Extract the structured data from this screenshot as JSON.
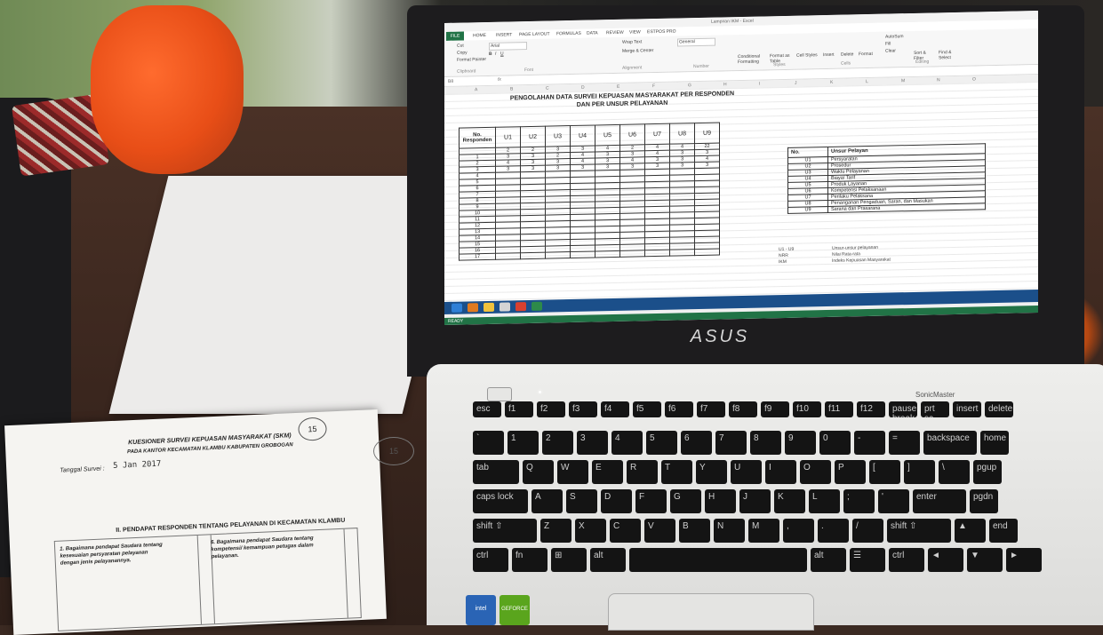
{
  "excel": {
    "window_title": "Lampiran IKM - Excel",
    "tabs": [
      "FILE",
      "HOME",
      "INSERT",
      "PAGE LAYOUT",
      "FORMULAS",
      "DATA",
      "REVIEW",
      "VIEW",
      "ESTPOS PRO"
    ],
    "ribbon": {
      "cut": "Cut",
      "copy": "Copy",
      "format_painter": "Format Painter",
      "font": "Arial",
      "wrap_text": "Wrap Text",
      "merge_center": "Merge & Center",
      "number_format": "General",
      "conditional_formatting": "Conditional Formatting",
      "format_as_table": "Format as Table",
      "cell_styles": "Cell Styles",
      "insert": "Insert",
      "delete": "Delete",
      "format": "Format",
      "autosum": "AutoSum",
      "fill": "Fill",
      "clear": "Clear",
      "sort_filter": "Sort & Filter",
      "find_select": "Find & Select",
      "groups": [
        "Clipboard",
        "Font",
        "Alignment",
        "Number",
        "Styles",
        "Cells",
        "Editing"
      ]
    },
    "name_box": "B8",
    "columns": [
      "A",
      "B",
      "C",
      "D",
      "E",
      "F",
      "G",
      "H",
      "I",
      "J",
      "K",
      "L",
      "M",
      "N",
      "O"
    ],
    "sheet_title_line1": "PENGOLAHAN DATA SURVEI KEPUASAN MASYARAKAT PER RESPONDEN",
    "sheet_title_line2": "DAN PER UNSUR PELAYANAN",
    "table": {
      "header_no": "No. Responden",
      "header_units": [
        "U1",
        "U2",
        "U3",
        "U4",
        "U5",
        "U6",
        "U7",
        "U8",
        "U9"
      ],
      "top_row": [
        "",
        "2",
        "2",
        "3",
        "3",
        "4",
        "2",
        "4",
        "4",
        "22"
      ],
      "rows": [
        [
          "1",
          "3",
          "3",
          "2",
          "4",
          "3",
          "3",
          "4",
          "3",
          "3"
        ],
        [
          "2",
          "4",
          "3",
          "3",
          "4",
          "3",
          "4",
          "3",
          "3",
          "4"
        ],
        [
          "3",
          "3",
          "3",
          "3",
          "3",
          "3",
          "3",
          "3",
          "3",
          "3"
        ],
        [
          "4",
          "",
          "",
          "",
          "",
          "",
          "",
          "",
          "",
          ""
        ],
        [
          "5",
          "",
          "",
          "",
          "",
          "",
          "",
          "",
          "",
          ""
        ],
        [
          "6",
          "",
          "",
          "",
          "",
          "",
          "",
          "",
          "",
          ""
        ],
        [
          "7",
          "",
          "",
          "",
          "",
          "",
          "",
          "",
          "",
          ""
        ],
        [
          "8",
          "",
          "",
          "",
          "",
          "",
          "",
          "",
          "",
          ""
        ],
        [
          "9",
          "",
          "",
          "",
          "",
          "",
          "",
          "",
          "",
          ""
        ],
        [
          "10",
          "",
          "",
          "",
          "",
          "",
          "",
          "",
          "",
          ""
        ],
        [
          "11",
          "",
          "",
          "",
          "",
          "",
          "",
          "",
          "",
          ""
        ],
        [
          "12",
          "",
          "",
          "",
          "",
          "",
          "",
          "",
          "",
          ""
        ],
        [
          "13",
          "",
          "",
          "",
          "",
          "",
          "",
          "",
          "",
          ""
        ],
        [
          "14",
          "",
          "",
          "",
          "",
          "",
          "",
          "",
          "",
          ""
        ],
        [
          "15",
          "",
          "",
          "",
          "",
          "",
          "",
          "",
          "",
          ""
        ],
        [
          "16",
          "",
          "",
          "",
          "",
          "",
          "",
          "",
          "",
          ""
        ],
        [
          "17",
          "",
          "",
          "",
          "",
          "",
          "",
          "",
          "",
          ""
        ]
      ]
    },
    "unsur_table": {
      "header_no": "No.",
      "header_label": "Unsur Pelayan",
      "rows": [
        [
          "U1",
          "Persyaratan"
        ],
        [
          "U2",
          "Prosedur"
        ],
        [
          "U3",
          "Waktu Pelayanan"
        ],
        [
          "U4",
          "Biaya/ Tarif"
        ],
        [
          "U5",
          "Produk Layanan"
        ],
        [
          "U6",
          "Kompetensi Pelaksanaan"
        ],
        [
          "U7",
          "Perilaku Pelaksana"
        ],
        [
          "U8",
          "Penanganan Pengaduan, Saran, dan Masukan"
        ],
        [
          "U9",
          "Sarana dan Prasarana"
        ]
      ]
    },
    "legend": [
      [
        "U1 - U9",
        "Unsur-unsur pelayanan"
      ],
      [
        "NRR",
        "Nilai Rata-rata"
      ],
      [
        "IKM",
        "Indeks Kepuasan Masyarakat"
      ]
    ],
    "status": "READY"
  },
  "laptop": {
    "brand": "ASUS",
    "sonic_master": "SonicMaster",
    "stickers": [
      "intel",
      "GEFORCE"
    ],
    "keys": {
      "row1": [
        "esc",
        "f1",
        "f2",
        "f3",
        "f4",
        "f5",
        "f6",
        "f7",
        "f8",
        "f9",
        "f10",
        "f11",
        "f12",
        "pause break",
        "prt sc sysrq",
        "insert",
        "delete"
      ],
      "row2": [
        "`",
        "1",
        "2",
        "3",
        "4",
        "5",
        "6",
        "7",
        "8",
        "9",
        "0",
        "-",
        "=",
        "backspace",
        "home"
      ],
      "row3": [
        "tab",
        "Q",
        "W",
        "E",
        "R",
        "T",
        "Y",
        "U",
        "I",
        "O",
        "P",
        "[",
        "]",
        "\\",
        "pgup"
      ],
      "row4": [
        "caps lock",
        "A",
        "S",
        "D",
        "F",
        "G",
        "H",
        "J",
        "K",
        "L",
        ";",
        "'",
        "enter",
        "pgdn"
      ],
      "row5": [
        "shift ⇧",
        "Z",
        "X",
        "C",
        "V",
        "B",
        "N",
        "M",
        ",",
        ".",
        "/",
        "shift ⇧",
        "▲",
        "end"
      ],
      "row6": [
        "ctrl",
        "fn",
        "⊞",
        "alt",
        "",
        "alt",
        "☰",
        "ctrl",
        "◄",
        "▼",
        "►"
      ]
    }
  },
  "questionnaire": {
    "title": "KUESIONER SURVEI KEPUASAN MASYARAKAT (SKM)",
    "subtitle": "PADA KANTOR KECAMATAN KLAMBU KABUPATEN GROBOGAN",
    "date_label": "Tanggal Survei :",
    "date_value": "5 Jan 2017",
    "respondent_number": "15",
    "section_heading": "II. PENDAPAT RESPONDEN TENTANG PELAYANAN DI KECAMATAN KLAMBU",
    "q1": "1. Bagaimana pendapat Saudara tentang kesesuaian persyaratan pelayanan dengan jenis pelayanannya.",
    "q2": "6. Bagaimana pendapat Saudara tentang kompetensi/ kemampuan petugas dalam pelayanan.",
    "page_number": "15"
  }
}
